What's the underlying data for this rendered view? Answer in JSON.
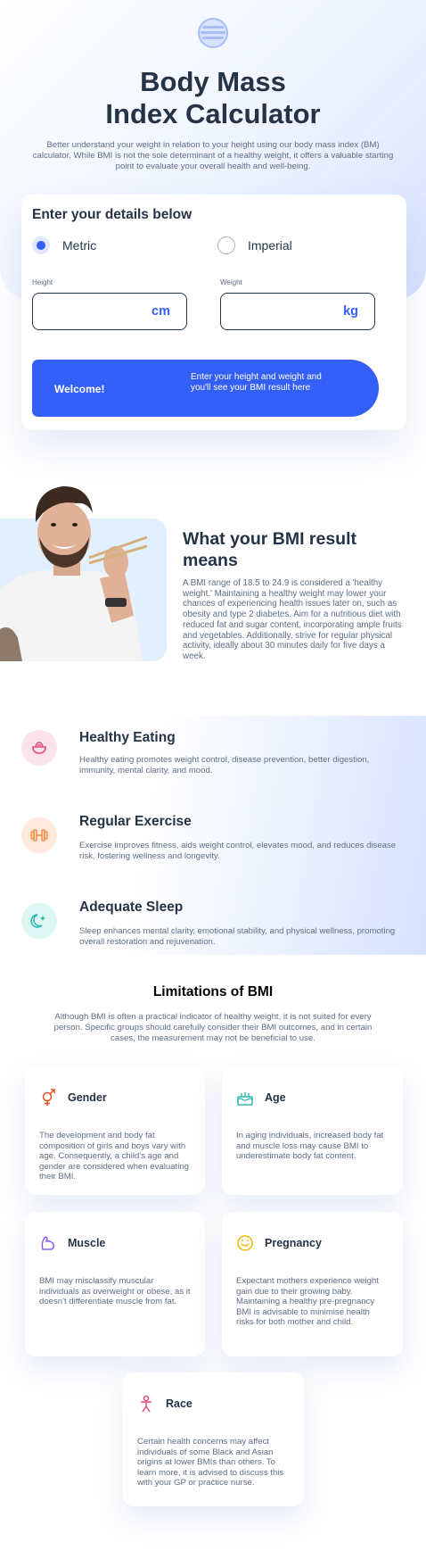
{
  "hero": {
    "title_line1": "Body Mass",
    "title_line2": "Index Calculator",
    "description": "Better understand your weight in relation to your height using our body mass index (BM) calculator. While BMI is not the sole determinant of a healthy weight, it offers a valuable starting point to evaluate your overall health and well-being."
  },
  "form": {
    "heading": "Enter your details below",
    "units": [
      {
        "label": "Metric",
        "selected": true
      },
      {
        "label": "Imperial",
        "selected": false
      }
    ],
    "height": {
      "label": "Height",
      "value": "",
      "unit": "cm"
    },
    "weight": {
      "label": "Weight",
      "value": "",
      "unit": "kg"
    },
    "result": {
      "welcome": "Welcome!",
      "message": "Enter your height and weight and you'll see your BMI result here"
    }
  },
  "meaning": {
    "title": "What your BMI result means",
    "text": "A BMI range of 18.5 to 24.9 is considered a 'healthy weight.' Maintaining a healthy weight may lower your chances of experiencing health issues later on, such as obesity and type 2 diabetes. Aim for a nutritious diet with reduced fat and sugar content, incorporating ample fruits and vegetables. Additionally, strive for regular physical activity, ideally about 30 minutes daily for five days a week."
  },
  "tips": [
    {
      "title": "Healthy Eating",
      "text": "Healthy eating promotes weight control, disease prevention, better digestion, immunity, mental clarity, and mood.",
      "icon": "bowl-icon",
      "color": "#e74a7d",
      "bg": "#fbe3ec"
    },
    {
      "title": "Regular Exercise",
      "text": "Exercise improves fitness, aids weight control, elevates mood, and reduces disease risk, fostering wellness and longevity.",
      "icon": "dumbbell-icon",
      "color": "#f08a3c",
      "bg": "#fdeadc"
    },
    {
      "title": "Adequate Sleep",
      "text": "Sleep enhances mental clarity, emotional stability, and physical wellness, promoting overall restoration and rejuvenation.",
      "icon": "moon-icon",
      "color": "#29b8b0",
      "bg": "#ddf5f3"
    }
  ],
  "limitations": {
    "title": "Limitations of BMI",
    "text": "Although BMI is often a practical indicator of healthy weight, it is not suited for every person. Specific groups should carefully consider their BMI outcomes, and in certain cases, the measurement may not be beneficial to use.",
    "cards": {
      "gender": {
        "title": "Gender",
        "text": "The development and body fat composition of girls and boys vary with age. Consequently, a child's age and gender are considered when evaluating their BMI.",
        "icon": "gender-icon",
        "color": "#e5531a"
      },
      "age": {
        "title": "Age",
        "text": "In aging individuals, increased body fat and muscle loss may cause BMI to underestimate body fat content.",
        "icon": "cake-icon",
        "color": "#29b8b0"
      },
      "muscle": {
        "title": "Muscle",
        "text": "BMI may misclassify muscular individuals as overweight or obese, as it doesn't differentiate muscle from fat.",
        "icon": "muscle-icon",
        "color": "#8a5cf5"
      },
      "pregnancy": {
        "title": "Pregnancy",
        "text": "Expectant mothers experience weight gain due to their growing baby. Maintaining a healthy pre-pregnancy BMI is advisable to minimise health risks for both mother and child.",
        "icon": "pregnancy-icon",
        "color": "#f2b600"
      },
      "race": {
        "title": "Race",
        "text": "Certain health concerns may affect individuals of some Black and Asian origins at lower BMIs than others. To learn more, it is advised to discuss this with your GP or practice nurse.",
        "icon": "person-icon",
        "color": "#e74a7d"
      }
    }
  }
}
